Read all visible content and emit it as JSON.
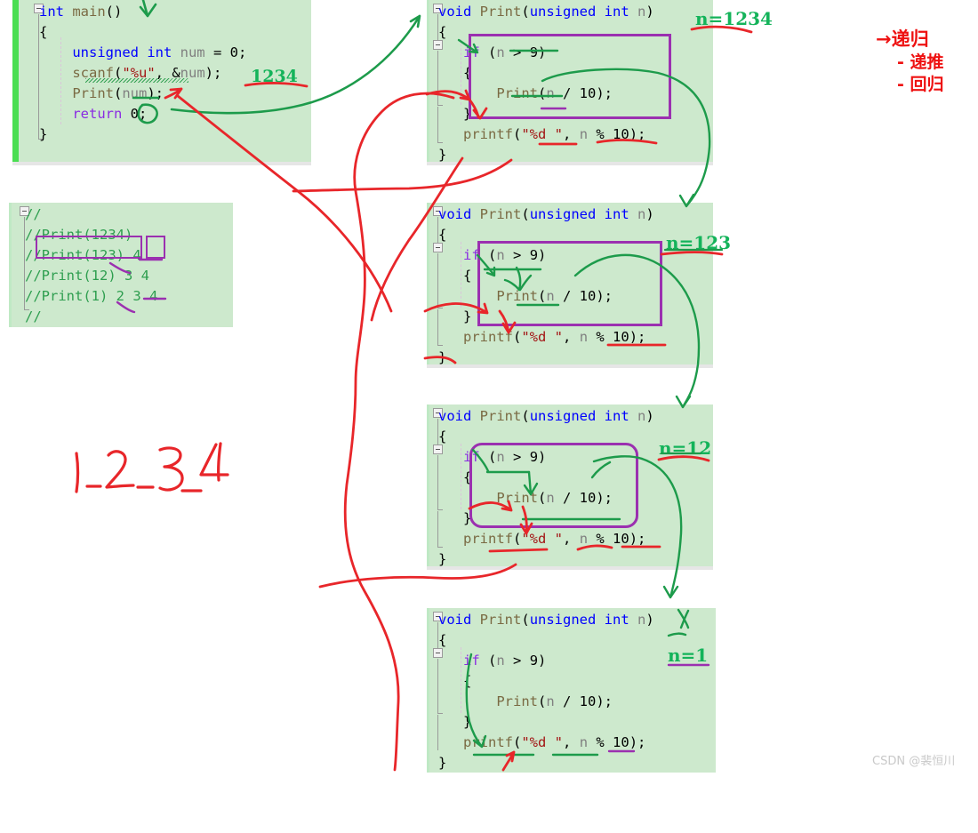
{
  "page": {
    "watermark": "CSDN @裴恒川"
  },
  "main_block": {
    "name": "main-function",
    "lines": [
      [
        {
          "t": "int ",
          "c": "kw"
        },
        {
          "t": "main",
          "c": "fn"
        },
        {
          "t": "()",
          "c": "pun"
        }
      ],
      [
        {
          "t": "{",
          "c": "pun"
        }
      ],
      [
        {
          "t": "    unsigned int ",
          "c": "kw"
        },
        {
          "t": "num",
          "c": "id"
        },
        {
          "t": " = ",
          "c": "pun"
        },
        {
          "t": "0",
          "c": "num"
        },
        {
          "t": ";",
          "c": "pun"
        }
      ],
      [
        {
          "t": "    scanf",
          "c": "fn"
        },
        {
          "t": "(",
          "c": "pun"
        },
        {
          "t": "\"%u\"",
          "c": "str"
        },
        {
          "t": ", &",
          "c": "pun"
        },
        {
          "t": "num",
          "c": "id"
        },
        {
          "t": ");",
          "c": "pun"
        }
      ],
      [
        {
          "t": "    Print",
          "c": "fn"
        },
        {
          "t": "(",
          "c": "pun"
        },
        {
          "t": "num",
          "c": "id"
        },
        {
          "t": ");",
          "c": "pun"
        }
      ],
      [
        {
          "t": "    return ",
          "c": "kw2"
        },
        {
          "t": "0",
          "c": "num"
        },
        {
          "t": ";",
          "c": "pun"
        }
      ],
      [
        {
          "t": "}",
          "c": "pun"
        }
      ]
    ]
  },
  "comment_block": {
    "name": "trace-comment",
    "lines": [
      "//",
      "//Print(1234)",
      "//Print(123) 4",
      "//Print(12) 3 4",
      "//Print(1) 2 3 4",
      "//"
    ]
  },
  "print_blocks": [
    {
      "name": "print-call-1234",
      "n_label": "n=1234",
      "underline_color": "#e02020",
      "box_style": "square",
      "lines": [
        [
          {
            "t": "void ",
            "c": "kw"
          },
          {
            "t": "Print",
            "c": "fn"
          },
          {
            "t": "(",
            "c": "pun"
          },
          {
            "t": "unsigned int ",
            "c": "kw"
          },
          {
            "t": "n",
            "c": "id"
          },
          {
            "t": ")",
            "c": "pun"
          }
        ],
        [
          {
            "t": "{",
            "c": "pun"
          }
        ],
        [
          {
            "t": "   if ",
            "c": "kw2"
          },
          {
            "t": "(",
            "c": "pun"
          },
          {
            "t": "n",
            "c": "id"
          },
          {
            "t": " > ",
            "c": "pun"
          },
          {
            "t": "9",
            "c": "num"
          },
          {
            "t": ")",
            "c": "pun"
          }
        ],
        [
          {
            "t": "   {",
            "c": "pun"
          }
        ],
        [
          {
            "t": "       Print",
            "c": "fn"
          },
          {
            "t": "(",
            "c": "pun"
          },
          {
            "t": "n",
            "c": "id"
          },
          {
            "t": " / ",
            "c": "pun"
          },
          {
            "t": "10",
            "c": "num"
          },
          {
            "t": ");",
            "c": "pun"
          }
        ],
        [
          {
            "t": "   }",
            "c": "pun"
          }
        ],
        [
          {
            "t": "   printf",
            "c": "fn"
          },
          {
            "t": "(",
            "c": "pun"
          },
          {
            "t": "\"%d \"",
            "c": "str"
          },
          {
            "t": ", ",
            "c": "pun"
          },
          {
            "t": "n",
            "c": "id"
          },
          {
            "t": " % ",
            "c": "pun"
          },
          {
            "t": "10",
            "c": "num"
          },
          {
            "t": ");",
            "c": "pun"
          }
        ],
        [
          {
            "t": "}",
            "c": "pun"
          }
        ]
      ]
    },
    {
      "name": "print-call-123",
      "n_label": "n=123",
      "underline_color": "#e02020",
      "box_style": "square",
      "lines": [
        [
          {
            "t": "void ",
            "c": "kw"
          },
          {
            "t": "Print",
            "c": "fn"
          },
          {
            "t": "(",
            "c": "pun"
          },
          {
            "t": "unsigned int ",
            "c": "kw"
          },
          {
            "t": "n",
            "c": "id"
          },
          {
            "t": ")",
            "c": "pun"
          }
        ],
        [
          {
            "t": "{",
            "c": "pun"
          }
        ],
        [
          {
            "t": "   if ",
            "c": "kw2"
          },
          {
            "t": "(",
            "c": "pun"
          },
          {
            "t": "n",
            "c": "id"
          },
          {
            "t": " > ",
            "c": "pun"
          },
          {
            "t": "9",
            "c": "num"
          },
          {
            "t": ")",
            "c": "pun"
          }
        ],
        [
          {
            "t": "   {",
            "c": "pun"
          }
        ],
        [
          {
            "t": "       Print",
            "c": "fn"
          },
          {
            "t": "(",
            "c": "pun"
          },
          {
            "t": "n",
            "c": "id"
          },
          {
            "t": " / ",
            "c": "pun"
          },
          {
            "t": "10",
            "c": "num"
          },
          {
            "t": ");",
            "c": "pun"
          }
        ],
        [
          {
            "t": "   }",
            "c": "pun"
          }
        ],
        [
          {
            "t": "   printf",
            "c": "fn"
          },
          {
            "t": "(",
            "c": "pun"
          },
          {
            "t": "\"%d \"",
            "c": "str"
          },
          {
            "t": ", ",
            "c": "pun"
          },
          {
            "t": "n",
            "c": "id"
          },
          {
            "t": " % ",
            "c": "pun"
          },
          {
            "t": "10",
            "c": "num"
          },
          {
            "t": ");",
            "c": "pun"
          }
        ],
        [
          {
            "t": "}",
            "c": "pun"
          }
        ]
      ]
    },
    {
      "name": "print-call-12",
      "n_label": "n=12",
      "underline_color": "#e02020",
      "box_style": "round",
      "lines": [
        [
          {
            "t": "void ",
            "c": "kw"
          },
          {
            "t": "Print",
            "c": "fn"
          },
          {
            "t": "(",
            "c": "pun"
          },
          {
            "t": "unsigned int ",
            "c": "kw"
          },
          {
            "t": "n",
            "c": "id"
          },
          {
            "t": ")",
            "c": "pun"
          }
        ],
        [
          {
            "t": "{",
            "c": "pun"
          }
        ],
        [
          {
            "t": "   if ",
            "c": "kw2"
          },
          {
            "t": "(",
            "c": "pun"
          },
          {
            "t": "n",
            "c": "id"
          },
          {
            "t": " > ",
            "c": "pun"
          },
          {
            "t": "9",
            "c": "num"
          },
          {
            "t": ")",
            "c": "pun"
          }
        ],
        [
          {
            "t": "   {",
            "c": "pun"
          }
        ],
        [
          {
            "t": "       Print",
            "c": "fn"
          },
          {
            "t": "(",
            "c": "pun"
          },
          {
            "t": "n",
            "c": "id"
          },
          {
            "t": " / ",
            "c": "pun"
          },
          {
            "t": "10",
            "c": "num"
          },
          {
            "t": ");",
            "c": "pun"
          }
        ],
        [
          {
            "t": "   }",
            "c": "pun"
          }
        ],
        [
          {
            "t": "   printf",
            "c": "fn"
          },
          {
            "t": "(",
            "c": "pun"
          },
          {
            "t": "\"%d \"",
            "c": "str"
          },
          {
            "t": ", ",
            "c": "pun"
          },
          {
            "t": "n",
            "c": "id"
          },
          {
            "t": " % ",
            "c": "pun"
          },
          {
            "t": "10",
            "c": "num"
          },
          {
            "t": ");",
            "c": "pun"
          }
        ],
        [
          {
            "t": "}",
            "c": "pun"
          }
        ]
      ]
    },
    {
      "name": "print-call-1",
      "n_label": "n=1",
      "underline_color": "#9b30b0",
      "box_style": "none",
      "lines": [
        [
          {
            "t": "void ",
            "c": "kw"
          },
          {
            "t": "Print",
            "c": "fn"
          },
          {
            "t": "(",
            "c": "pun"
          },
          {
            "t": "unsigned int ",
            "c": "kw"
          },
          {
            "t": "n",
            "c": "id"
          },
          {
            "t": ")",
            "c": "pun"
          }
        ],
        [
          {
            "t": "{",
            "c": "pun"
          }
        ],
        [
          {
            "t": "   if ",
            "c": "kw2"
          },
          {
            "t": "(",
            "c": "pun"
          },
          {
            "t": "n",
            "c": "id"
          },
          {
            "t": " > ",
            "c": "pun"
          },
          {
            "t": "9",
            "c": "num"
          },
          {
            "t": ")",
            "c": "pun"
          }
        ],
        [
          {
            "t": "   {",
            "c": "pun"
          }
        ],
        [
          {
            "t": "       Print",
            "c": "fn"
          },
          {
            "t": "(",
            "c": "pun"
          },
          {
            "t": "n",
            "c": "id"
          },
          {
            "t": " / ",
            "c": "pun"
          },
          {
            "t": "10",
            "c": "num"
          },
          {
            "t": ");",
            "c": "pun"
          }
        ],
        [
          {
            "t": "   }",
            "c": "pun"
          }
        ],
        [
          {
            "t": "   printf",
            "c": "fn"
          },
          {
            "t": "(",
            "c": "pun"
          },
          {
            "t": "\"%d \"",
            "c": "str"
          },
          {
            "t": ", ",
            "c": "pun"
          },
          {
            "t": "n",
            "c": "id"
          },
          {
            "t": " % ",
            "c": "pun"
          },
          {
            "t": "10",
            "c": "num"
          },
          {
            "t": ");",
            "c": "pun"
          }
        ],
        [
          {
            "t": "}",
            "c": "pun"
          }
        ]
      ]
    }
  ],
  "annotations": {
    "input_value": "1234",
    "sequence": "1 2 3 4",
    "chinese_title": "→递归",
    "chinese_items": [
      "- 递推",
      "- 回归"
    ],
    "ink_red": "#e8262a",
    "ink_green": "#1d9b4b",
    "ink_purple": "#9b30b0"
  }
}
